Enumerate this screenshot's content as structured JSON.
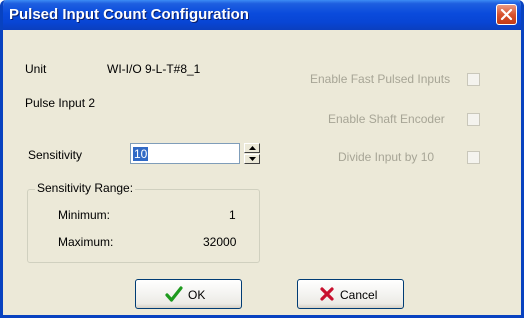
{
  "window": {
    "title": "Pulsed Input Count Configuration"
  },
  "unit": {
    "label": "Unit",
    "value": "WI-I/O 9-L-T#8_1"
  },
  "pulse_input": "Pulse Input 2",
  "sensitivity": {
    "label": "Sensitivity",
    "value": "10"
  },
  "range": {
    "title": "Sensitivity Range:",
    "min_label": "Minimum:",
    "min_value": "1",
    "max_label": "Maximum:",
    "max_value": "32000"
  },
  "options": {
    "fast_pulsed": "Enable Fast Pulsed Inputs",
    "shaft_encoder": "Enable Shaft Encoder",
    "divide": "Divide Input by 10"
  },
  "buttons": {
    "ok": "OK",
    "cancel": "Cancel"
  },
  "colors": {
    "titlebar": "#0A4BDC",
    "face": "#ECE9D8",
    "selection": "#316AC5",
    "ok_check": "#1E9A1E",
    "cancel_x": "#C8102E"
  }
}
